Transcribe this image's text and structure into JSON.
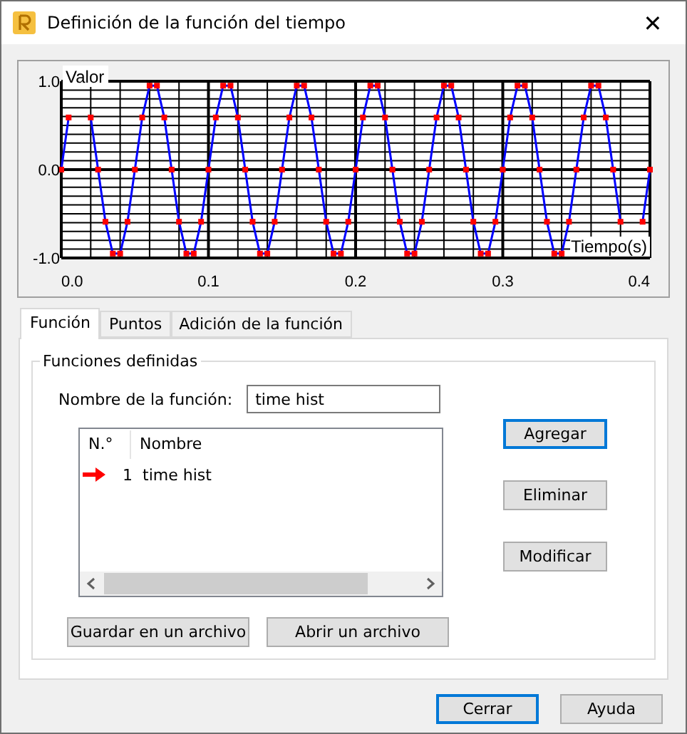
{
  "window": {
    "title": "Definición de la función del tiempo",
    "close": "✕"
  },
  "chart": {
    "chart_data": {
      "type": "line",
      "xlabel": "Tiempo(s)",
      "ylabel": "Valor",
      "xlim": [
        0,
        0.4
      ],
      "ylim": [
        -1,
        1
      ],
      "xticks": [
        {
          "value": 0,
          "label": "0.0"
        },
        {
          "value": 0.1,
          "label": "0.1"
        },
        {
          "value": 0.2,
          "label": "0.2"
        },
        {
          "value": 0.3,
          "label": "0.3"
        },
        {
          "value": 0.4,
          "label": "0.4"
        }
      ],
      "yticks": [
        {
          "value": -1,
          "label": "-1.0"
        },
        {
          "value": 0,
          "label": "0.0"
        },
        {
          "value": 1,
          "label": "1.0"
        }
      ],
      "x": [
        0,
        0.005,
        0.01,
        0.015,
        0.02,
        0.025,
        0.03,
        0.035,
        0.04,
        0.045,
        0.05,
        0.055,
        0.06,
        0.065,
        0.07,
        0.075,
        0.08,
        0.085,
        0.09,
        0.095,
        0.1,
        0.105,
        0.11,
        0.115,
        0.12,
        0.125,
        0.13,
        0.135,
        0.14,
        0.145,
        0.15,
        0.155,
        0.16,
        0.165,
        0.17,
        0.175,
        0.18,
        0.185,
        0.19,
        0.195,
        0.2,
        0.205,
        0.21,
        0.215,
        0.22,
        0.225,
        0.23,
        0.235,
        0.24,
        0.245,
        0.25,
        0.255,
        0.26,
        0.265,
        0.27,
        0.275,
        0.28,
        0.285,
        0.29,
        0.295,
        0.3,
        0.305,
        0.31,
        0.315,
        0.32,
        0.325,
        0.33,
        0.335,
        0.34,
        0.345,
        0.35,
        0.355,
        0.36,
        0.365,
        0.37,
        0.375,
        0.38,
        0.385,
        0.39,
        0.395,
        0.4
      ],
      "grid": true,
      "series": [
        {
          "color": "#ff0000",
          "marker": "square",
          "values": [
            0,
            0.59,
            null,
            null,
            0.59,
            0,
            -0.59,
            -0.95,
            -0.95,
            -0.59,
            0,
            0.59,
            0.95,
            0.95,
            0.59,
            0,
            -0.59,
            -0.95,
            -0.95,
            -0.59,
            0,
            0.59,
            0.95,
            0.95,
            0.59,
            0,
            -0.59,
            -0.95,
            -0.95,
            -0.59,
            0,
            0.59,
            0.95,
            0.95,
            0.59,
            0,
            -0.59,
            -0.95,
            -0.95,
            -0.59,
            0,
            0.59,
            0.95,
            0.95,
            0.59,
            0,
            -0.59,
            -0.95,
            -0.95,
            -0.59,
            0,
            0.59,
            0.95,
            0.95,
            0.59,
            0,
            -0.59,
            -0.95,
            -0.95,
            -0.59,
            0,
            0.59,
            0.95,
            0.95,
            0.59,
            0,
            -0.59,
            -0.95,
            -0.95,
            -0.59,
            0,
            0.59,
            0.95,
            0.95,
            0.59,
            0,
            -0.59,
            null,
            null,
            -0.59,
            0
          ]
        }
      ]
    }
  },
  "tabs": [
    {
      "label": "Función",
      "selected": true
    },
    {
      "label": "Puntos",
      "selected": false
    },
    {
      "label": "Adición de la función",
      "selected": false
    }
  ],
  "group": {
    "title": "Funciones definidas",
    "name_label": "Nombre de la función:",
    "name_value": "time hist",
    "list": {
      "columns": [
        "N.°",
        "Nombre"
      ],
      "rows": [
        {
          "number": "1",
          "name": "time hist",
          "current": true
        }
      ]
    },
    "side_buttons": [
      {
        "label": "Agregar",
        "default": true
      },
      {
        "label": "Eliminar",
        "default": false
      },
      {
        "label": "Modificar",
        "default": false
      }
    ],
    "file_buttons": [
      {
        "label": "Guardar en un archivo",
        "default": false
      },
      {
        "label": "Abrir un archivo",
        "default": false
      }
    ]
  },
  "footer_buttons": [
    {
      "label": "Cerrar",
      "default": true
    },
    {
      "label": "Ayuda",
      "default": false
    }
  ]
}
